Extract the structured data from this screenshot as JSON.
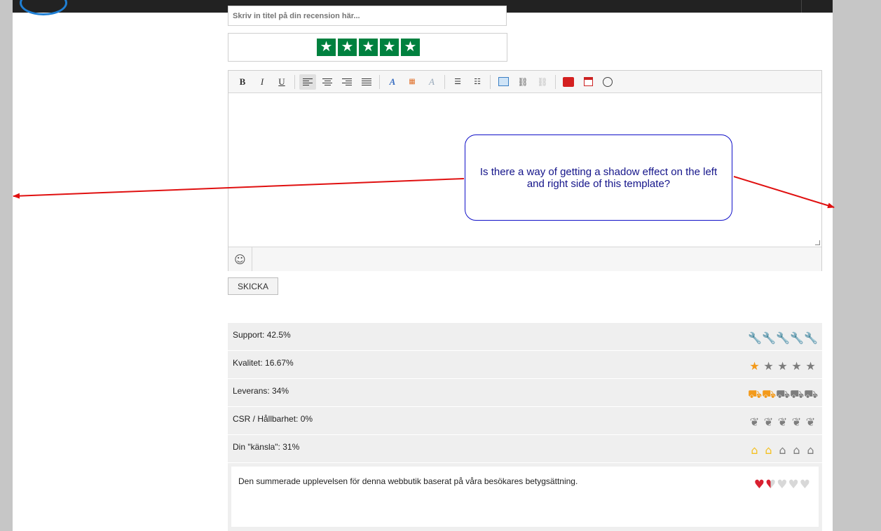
{
  "title_input": {
    "placeholder": "Skriv in titel på din recension här..."
  },
  "trustpilot_rating": {
    "stars_selected": 5,
    "stars_total": 5,
    "color": "#00813f"
  },
  "toolbar": {
    "bold": "B",
    "italic": "I",
    "underline": "U",
    "items": [
      "bold",
      "italic",
      "underline",
      "align-left",
      "align-center",
      "align-right",
      "justify",
      "font",
      "color",
      "remove-format",
      "bullet-list",
      "numbered-list",
      "image",
      "link",
      "unlink",
      "youtube",
      "date",
      "time"
    ]
  },
  "send_button": "SKICKA",
  "ratings": [
    {
      "label": "Support: 42.5%",
      "icon": "wrench-icon",
      "glyph": "🔧",
      "value": 42.5,
      "filled": 2,
      "color": "#f39a1b"
    },
    {
      "label": "Kvalitet: 16.67%",
      "icon": "star-icon",
      "glyph": "★",
      "value": 16.67,
      "filled": 1,
      "color": "#f39a1b"
    },
    {
      "label": "Leverans: 34%",
      "icon": "truck-icon",
      "glyph": "⛟",
      "value": 34,
      "filled": 2,
      "color": "#f39a1b"
    },
    {
      "label": "CSR / Hållbarhet: 0%",
      "icon": "leaf-icon",
      "glyph": "❦",
      "value": 0,
      "filled": 0,
      "color": "#78a828"
    },
    {
      "label": "Din \"känsla\": 31%",
      "icon": "house-icon",
      "glyph": "⌂",
      "value": 31,
      "filled": 2,
      "color": "#f4c020"
    }
  ],
  "summary": {
    "text": "Den summerade upplevelsen för denna webbutik baserat på våra besökares betygsättning.",
    "hearts_filled": 1.5,
    "hearts_total": 5,
    "heart_color": "#d92030"
  },
  "callout": {
    "text": "Is there a way of getting a shadow effect on the left and right side of this template?"
  }
}
